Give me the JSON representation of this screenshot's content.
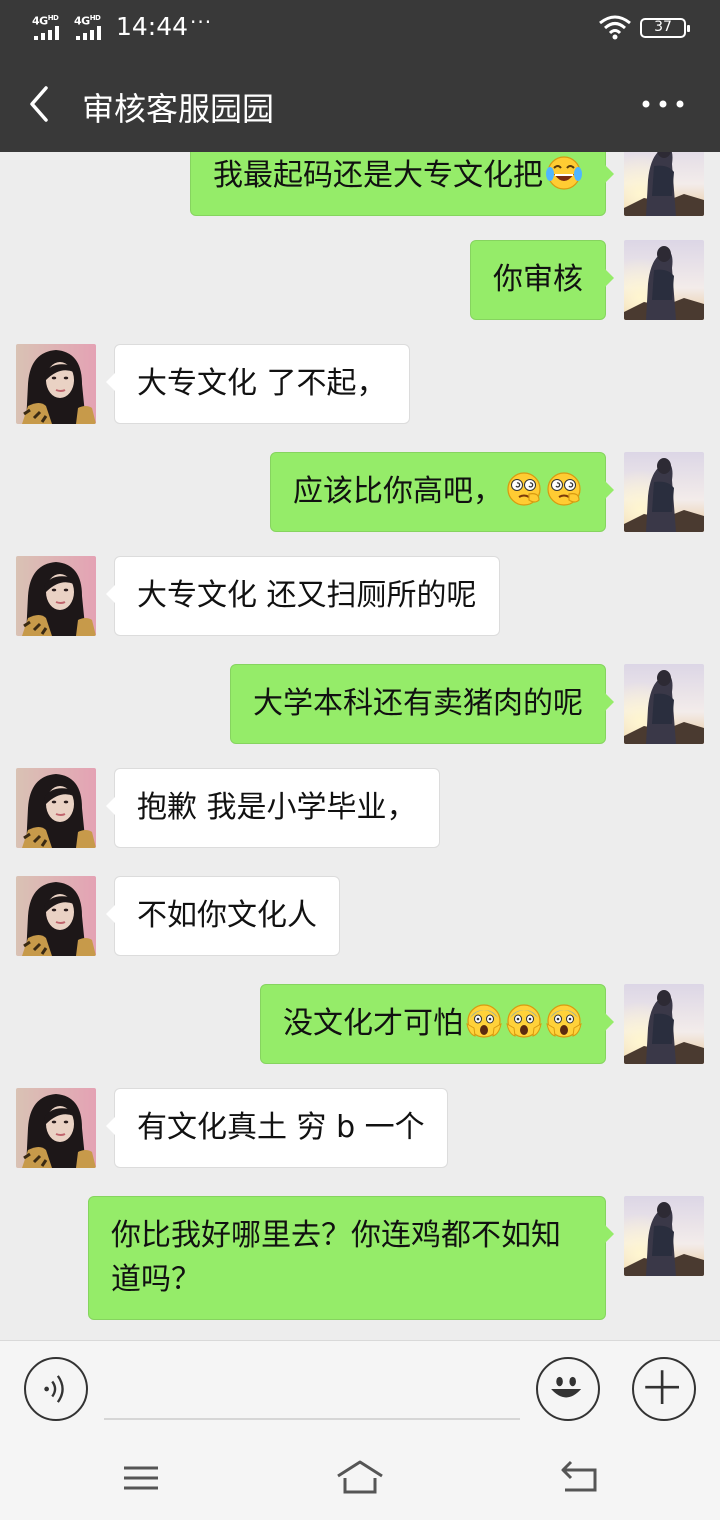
{
  "status_bar": {
    "signal1": "4G",
    "signal1_sup": "HD",
    "signal2": "4G",
    "signal2_sup": "HD",
    "time": "14:44",
    "more_dots": "···",
    "battery": "37"
  },
  "header": {
    "back_icon": "back-arrow-icon",
    "title": "审核客服园园",
    "more_icon": "more-dots-icon"
  },
  "messages": [
    {
      "side": "me",
      "text": "我最起码还是大专文化把",
      "emoji": [
        "tears-of-joy"
      ]
    },
    {
      "side": "me",
      "text": "你审核",
      "emoji": []
    },
    {
      "side": "other",
      "text": "大专文化 了不起，",
      "emoji": []
    },
    {
      "side": "me",
      "text": "应该比你高吧，",
      "emoji": [
        "dizzy-hmm",
        "dizzy-hmm"
      ]
    },
    {
      "side": "other",
      "text": "大专文化  还又扫厕所的呢",
      "emoji": []
    },
    {
      "side": "me",
      "text": "大学本科还有卖猪肉的呢",
      "emoji": []
    },
    {
      "side": "other",
      "text": "抱歉 我是小学毕业，",
      "emoji": []
    },
    {
      "side": "other",
      "text": "不如你文化人",
      "emoji": []
    },
    {
      "side": "me",
      "text": "没文化才可怕",
      "emoji": [
        "scream",
        "scream",
        "scream"
      ]
    },
    {
      "side": "other",
      "text": "有文化真土  穷 b  一个",
      "emoji": []
    },
    {
      "side": "me",
      "text": "你比我好哪里去？你连鸡都不如知道吗？",
      "emoji": []
    }
  ],
  "input_bar": {
    "voice_icon": "voice-icon",
    "emoji_icon": "smiley-icon",
    "plus_icon": "plus-icon"
  },
  "nav_bar": {
    "menu_icon": "menu-icon",
    "home_icon": "home-icon",
    "back_icon": "return-icon"
  },
  "colors": {
    "header_bg": "#393939",
    "chat_bg": "#ededed",
    "my_bubble": "#95ec69",
    "other_bubble": "#ffffff"
  }
}
